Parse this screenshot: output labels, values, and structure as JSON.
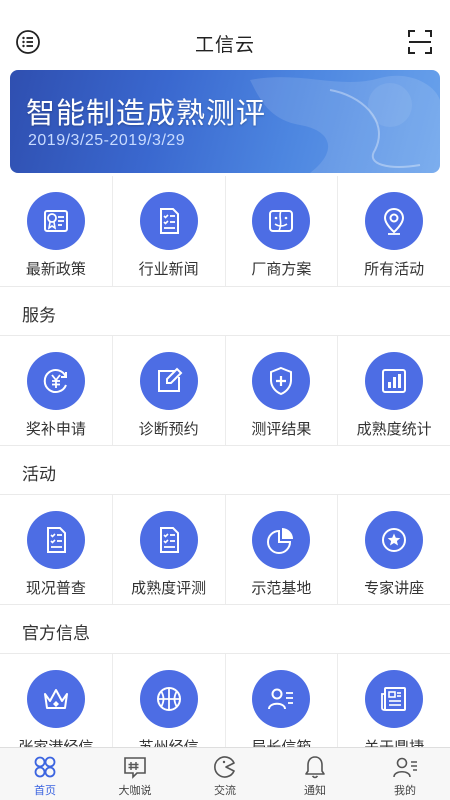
{
  "header": {
    "title": "工信云"
  },
  "banner": {
    "title": "智能制造成熟测评",
    "date": "2019/3/25-2019/3/29"
  },
  "top_grid": [
    {
      "label": "最新政策",
      "icon": "policy-icon"
    },
    {
      "label": "行业新闻",
      "icon": "news-icon"
    },
    {
      "label": "厂商方案",
      "icon": "vendor-solution-icon"
    },
    {
      "label": "所有活动",
      "icon": "location-pin-icon"
    }
  ],
  "services": {
    "title": "服务",
    "items": [
      {
        "label": "奖补申请",
        "icon": "yuan-icon"
      },
      {
        "label": "诊断预约",
        "icon": "edit-icon"
      },
      {
        "label": "测评结果",
        "icon": "shield-plus-icon"
      },
      {
        "label": "成熟度统计",
        "icon": "bar-chart-icon"
      }
    ]
  },
  "activities": {
    "title": "活动",
    "items": [
      {
        "label": "现况普查",
        "icon": "checklist-icon"
      },
      {
        "label": "成熟度评测",
        "icon": "checklist-icon"
      },
      {
        "label": "示范基地",
        "icon": "pie-chart-icon"
      },
      {
        "label": "专家讲座",
        "icon": "star-circle-icon"
      }
    ]
  },
  "official": {
    "title": "官方信息",
    "items": [
      {
        "label": "张家港经信",
        "icon": "crown-icon"
      },
      {
        "label": "苏州经信",
        "icon": "ball-icon"
      },
      {
        "label": "局长信箱",
        "icon": "contact-card-icon"
      },
      {
        "label": "关于鼎捷",
        "icon": "newspaper-icon"
      }
    ]
  },
  "tabbar": [
    {
      "label": "首页",
      "icon": "home-grid-icon",
      "active": true
    },
    {
      "label": "大咖说",
      "icon": "chat-icon"
    },
    {
      "label": "交流",
      "icon": "exchange-icon"
    },
    {
      "label": "通知",
      "icon": "bell-icon"
    },
    {
      "label": "我的",
      "icon": "profile-icon"
    }
  ],
  "colors": {
    "accent": "#4d6de4",
    "active_tab": "#3b64e0"
  }
}
